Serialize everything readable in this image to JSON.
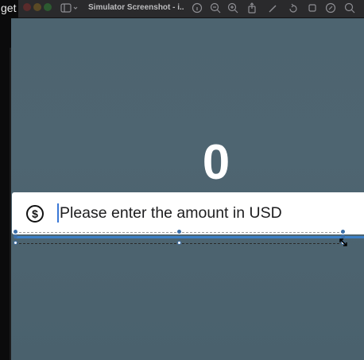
{
  "window": {
    "title": "Simulator Screenshot - i...",
    "behind_app_text": "get"
  },
  "toolbar": {
    "icons": [
      "sidebar-icon",
      "chevron-down-icon",
      "search-icon",
      "zoom-in-icon",
      "share-icon",
      "pen-icon",
      "rotate-icon",
      "markup-icon",
      "search-icon"
    ]
  },
  "screen": {
    "amount_display": "0",
    "input": {
      "placeholder": "Please enter the amount in USD",
      "icon": "dollar-circle-icon"
    }
  },
  "colors": {
    "screen_background": "#4e6571",
    "accent_blue": "#3c7fc6",
    "traffic_red": "#c0392b",
    "traffic_yellow": "#d4a017",
    "traffic_green": "#3a9a3a"
  }
}
